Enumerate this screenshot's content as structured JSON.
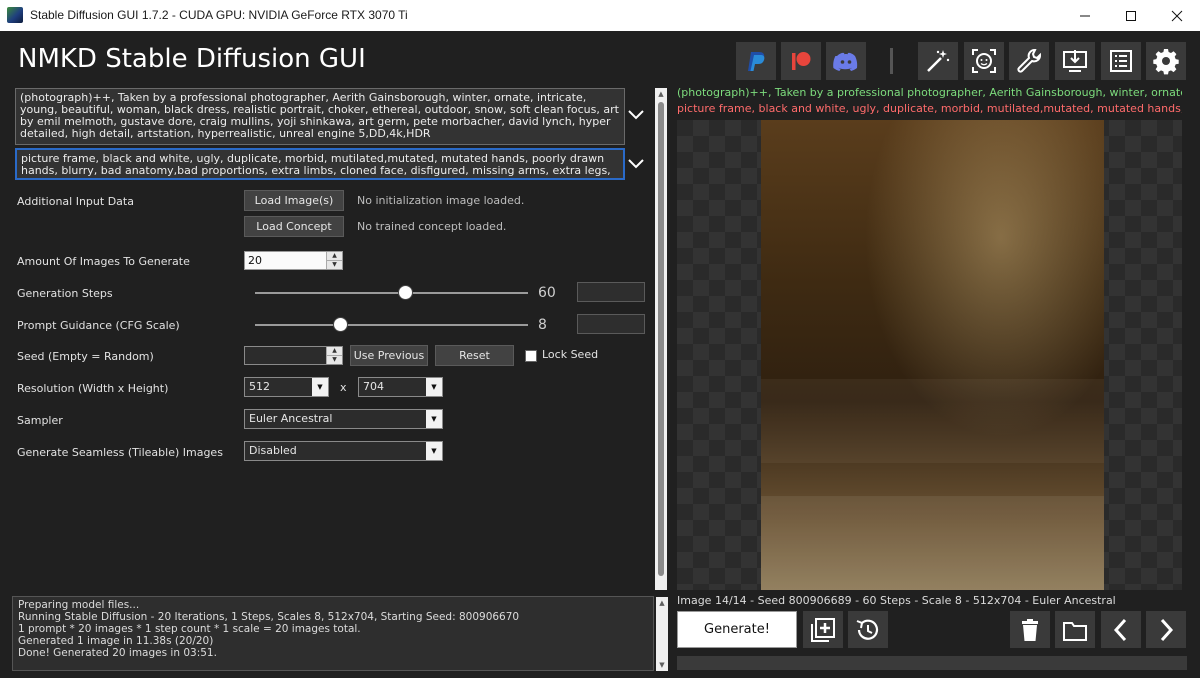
{
  "window": {
    "title": "Stable Diffusion GUI 1.7.2 - CUDA GPU: NVIDIA GeForce RTX 3070 Ti"
  },
  "app": {
    "title": "NMKD Stable Diffusion GUI"
  },
  "toolbar": {
    "buttons": [
      "paypal-icon",
      "patreon-icon",
      "discord-icon",
      "magic-wand-icon",
      "face-restore-icon",
      "wrench-icon",
      "install-icon",
      "log-list-icon",
      "settings-gear-icon"
    ]
  },
  "prompts": {
    "positive": "(photograph)++, Taken by a professional photographer, Aerith Gainsborough, winter, ornate, intricate, young, beautiful, woman, black dress, realistic portrait, choker, ethereal, outdoor, snow, soft clean focus, art by emil melmoth, gustave dore, craig mullins, yoji shinkawa, art germ, pete morbacher, david lynch, hyper detailed, high detail, artstation, hyperrealistic, unreal engine 5,DD,4k,HDR",
    "negative": "picture frame, black and white, ugly, duplicate, morbid, mutilated,mutated, mutated hands, poorly drawn hands, blurry, bad anatomy,bad proportions, extra limbs, cloned face, disfigured, missing arms, extra legs, extra fingers, text, user name,"
  },
  "settings": {
    "additional_input_label": "Additional Input Data",
    "load_images_button": "Load Image(s)",
    "no_init_image": "No initialization image loaded.",
    "load_concept_button": "Load Concept",
    "no_concept": "No trained concept loaded.",
    "amount_label": "Amount Of Images To Generate",
    "amount_value": "20",
    "steps_label": "Generation Steps",
    "steps_value": "60",
    "steps_fraction": 0.55,
    "cfg_label": "Prompt Guidance (CFG Scale)",
    "cfg_value": "8",
    "cfg_fraction": 0.31,
    "seed_label": "Seed (Empty = Random)",
    "seed_value": "",
    "use_previous_button": "Use Previous",
    "reset_button": "Reset",
    "lock_seed_label": "Lock Seed",
    "lock_seed_checked": false,
    "resolution_label": "Resolution (Width x Height)",
    "width_value": "512",
    "x_separator": "x",
    "height_value": "704",
    "sampler_label": "Sampler",
    "sampler_value": "Euler Ancestral",
    "seamless_label": "Generate Seamless (Tileable) Images",
    "seamless_value": "Disabled"
  },
  "log": {
    "lines": [
      "Preparing model files...",
      "Running Stable Diffusion - 20 Iterations, 1 Steps, Scales 8, 512x704, Starting Seed: 800906670",
      "1 prompt * 20 images * 1 step count * 1 scale = 20 images total.",
      "Generated 1 image in 11.38s (20/20)",
      "Done! Generated 20 images in 03:51."
    ]
  },
  "viewer": {
    "positive_prompt_preview": "(photograph)++, Taken by a professional photographer, Aerith Gainsborough, winter, ornate, intrica...",
    "negative_prompt_preview": "picture frame, black and white, ugly, duplicate, morbid, mutilated,mutated, mutated hands, poorly dra...",
    "image_info": "Image 14/14 - Seed 800906689 - 60 Steps - Scale 8 - 512x704 - Euler Ancestral",
    "generate_button": "Generate!"
  },
  "colors": {
    "positive_prompt": "#7ddc7d",
    "negative_prompt": "#ff6b6b",
    "accent_blue": "#2a6ac8"
  }
}
